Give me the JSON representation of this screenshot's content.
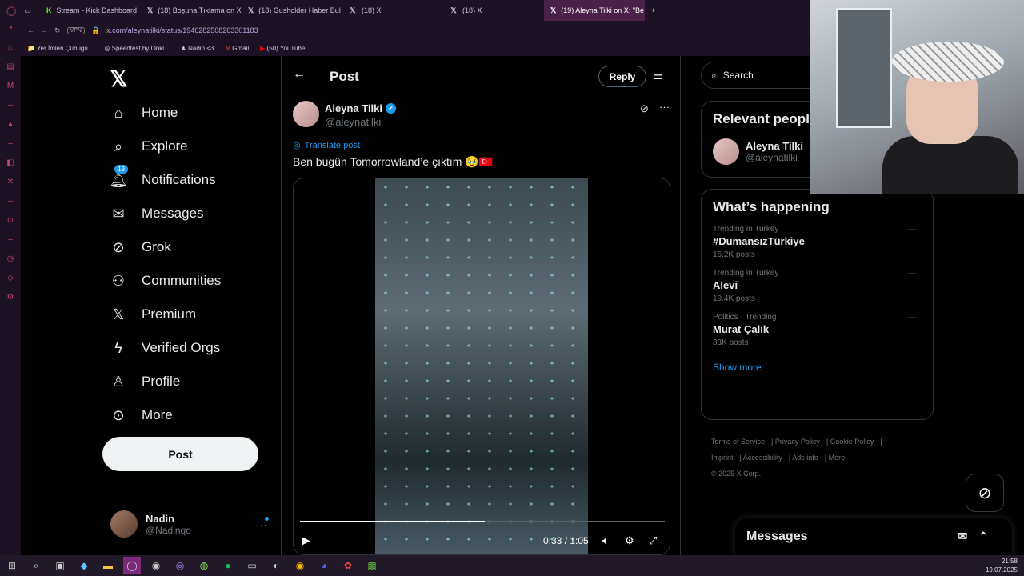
{
  "tabs": [
    {
      "label": "Stream - Kick Dashboard",
      "icon": "kick-icon"
    },
    {
      "label": "(18) Boşuna Tıklama on X:",
      "icon": "x-icon"
    },
    {
      "label": "(18) Gusholder Haber Bul",
      "icon": "x-icon"
    },
    {
      "label": "(18) X",
      "icon": "x-icon"
    },
    {
      "label": "(18) X",
      "icon": "x-icon"
    },
    {
      "label": "(19) Aleyna Tilki on X: \"Be",
      "icon": "x-icon",
      "active": true
    }
  ],
  "address": {
    "vpn": "VPN",
    "url": "x.com/aleynatilki/status/1946282508263301183"
  },
  "bookmarks": [
    "Yer İmleri Çubuğu...",
    "Speedtest by Ookl...",
    "Nadin <3",
    "Gmail",
    "(50) YouTube"
  ],
  "nav": {
    "home": "Home",
    "explore": "Explore",
    "notifications": "Notifications",
    "notif_badge": "19",
    "messages": "Messages",
    "grok": "Grok",
    "communities": "Communities",
    "premium": "Premium",
    "verified_orgs": "Verified Orgs",
    "profile": "Profile",
    "more": "More",
    "post_button": "Post"
  },
  "account": {
    "name": "Nadin",
    "handle": "@Nadinqo"
  },
  "main": {
    "title": "Post",
    "reply_button": "Reply",
    "tweet": {
      "author": "Aleyna Tilki",
      "handle": "@aleynatilki",
      "translate": "Translate post",
      "text": "Ben bugün Tomorrowland’e çıktım 🥹🇹🇷"
    },
    "video": {
      "time": "0:33 / 1:05",
      "progress_fraction": 0.507
    }
  },
  "right": {
    "search_placeholder": "Search",
    "relevant_title": "Relevant people",
    "relevant_name": "Aleyna Tilki",
    "relevant_handle": "@aleynatilki",
    "happening_title": "What’s happening",
    "trends": [
      {
        "meta": "Trending in Turkey",
        "name": "#DumansızTürkiye",
        "count": "15.2K posts"
      },
      {
        "meta": "Trending in Turkey",
        "name": "Alevi",
        "count": "19.4K posts"
      },
      {
        "meta": "Politics · Trending",
        "name": "Murat Çalık",
        "count": "83K posts"
      }
    ],
    "show_more": "Show more",
    "footer_links": [
      "Terms of Service",
      "Privacy Policy",
      "Cookie Policy",
      "Imprint",
      "Accessibility",
      "Ads info",
      "More ···"
    ],
    "copyright": "© 2025 X Corp."
  },
  "messages_bar": "Messages",
  "clock": {
    "time": "21:58",
    "date": "19.07.2025"
  },
  "colors": {
    "accent": "#1d9bf0",
    "bg": "#000000",
    "border": "#2f3336",
    "tab_active": "#4a2249"
  }
}
